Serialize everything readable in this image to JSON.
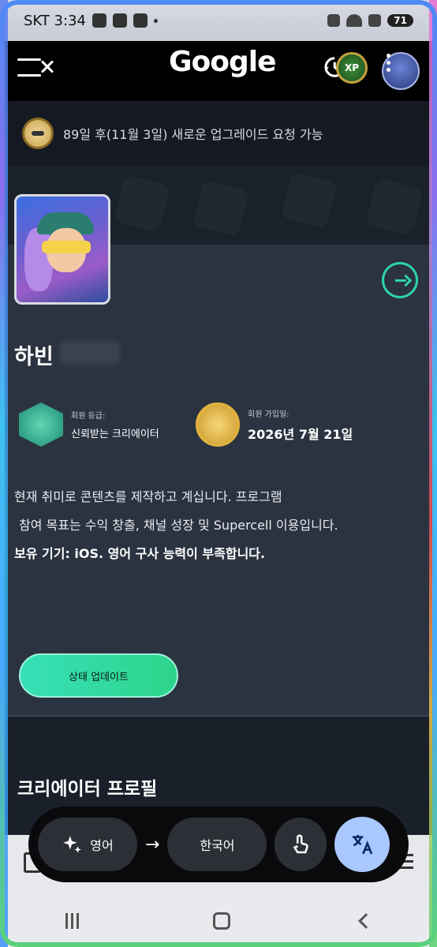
{
  "status_bar": {
    "carrier_time": "SKT 3:34",
    "battery": "71"
  },
  "header": {
    "logo": "Google",
    "xp_badge": "XP"
  },
  "notice": {
    "text": "89일 후(11월 3일) 새로운 업그레이드 요청 가능"
  },
  "profile": {
    "name": "하빈",
    "membership_label": "회원 등급:",
    "membership_value": "신뢰받는 크리에이터",
    "join_label": "회원 가입일:",
    "join_value": "2026년 7월 21일",
    "bio_line1": "현재 취미로 콘텐츠를 제작하고 계십니다. 프로그램",
    "bio_line2": "참여 목표는 수익 창출, 채널 성장 및 Supercell 이용입니다.",
    "bio_line3": "보유 기기: iOS. 영어 구사 능력이 부족합니다.",
    "update_button": "상태 업데이트"
  },
  "creator_profile": {
    "title": "크리에이터 프로필"
  },
  "translate_bar": {
    "source_lang": "영어",
    "target_lang": "한국어",
    "arrow": "→"
  },
  "colors": {
    "accent": "#2ed3a5",
    "translate_fab": "#a9c8ff"
  }
}
